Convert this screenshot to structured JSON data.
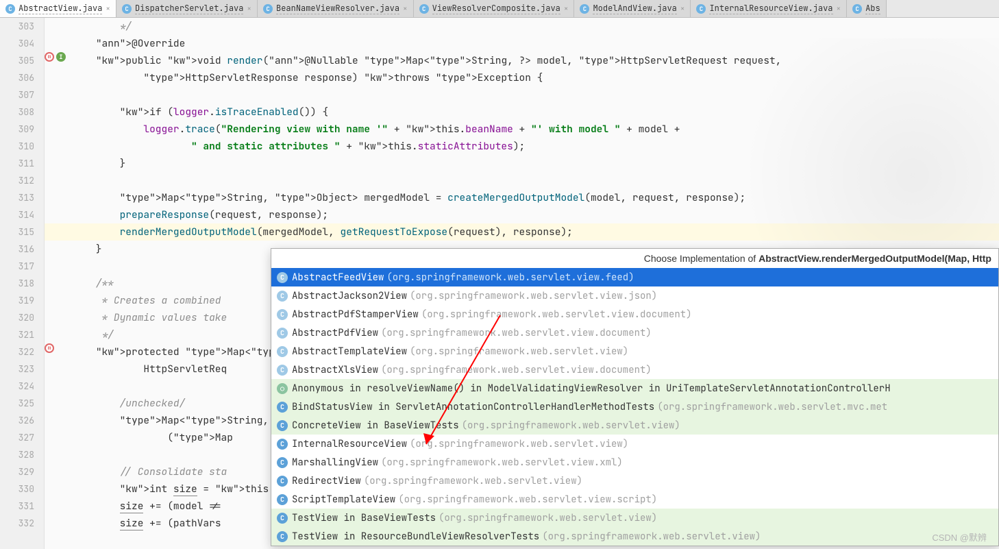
{
  "tabs": [
    {
      "label": "AbstractView.java",
      "active": true
    },
    {
      "label": "DispatcherServlet.java"
    },
    {
      "label": "BeanNameViewResolver.java"
    },
    {
      "label": "ViewResolverComposite.java"
    },
    {
      "label": "ModelAndView.java"
    },
    {
      "label": "InternalResourceView.java"
    },
    {
      "label": "Abs"
    }
  ],
  "gutter_start": 303,
  "gutter_end": 332,
  "code_lines": {
    "l303": "        */",
    "l304": "    @Override",
    "l305": "    public void render(@Nullable Map<String, ?> model, HttpServletRequest request,",
    "l306": "            HttpServletResponse response) throws Exception {",
    "l307": "",
    "l308": "        if (logger.isTraceEnabled()) {",
    "l309": "            logger.trace(\"Rendering view with name '\" + this.beanName + \"' with model \" + model +",
    "l310": "                    \" and static attributes \" + this.staticAttributes);",
    "l311": "        }",
    "l312": "",
    "l313": "        Map<String, Object> mergedModel = createMergedOutputModel(model, request, response);",
    "l314": "        prepareResponse(request, response);",
    "l315": "        renderMergedOutputModel(mergedModel, getRequestToExpose(request), response);",
    "l316": "    }",
    "l317": "",
    "l318": "    /**",
    "l319": "     * Creates a combined ",
    "l320": "     * Dynamic values take",
    "l321": "     */",
    "l322": "    protected Map<String, ",
    "l323": "            HttpServletReq",
    "l324": "",
    "l325": "        /unchecked/",
    "l326": "        Map<String, Object",
    "l327": "                (Map<Strin",
    "l328": "",
    "l329": "        // Consolidate sta",
    "l330": "        int size = this.st",
    "l331": "        size += (model != ",
    "l332": "        size += (pathVars "
  },
  "popup": {
    "title_prefix": "Choose Implementation of ",
    "title_bold": "AbstractView.renderMergedOutputModel(Map, Http",
    "items": [
      {
        "name": "AbstractFeedView",
        "pkg": "(org.springframework.web.servlet.view.feed)",
        "sel": true,
        "abs": true
      },
      {
        "name": "AbstractJackson2View",
        "pkg": "(org.springframework.web.servlet.view.json)",
        "abs": true
      },
      {
        "name": "AbstractPdfStamperView",
        "pkg": "(org.springframework.web.servlet.view.document)",
        "abs": true
      },
      {
        "name": "AbstractPdfView",
        "pkg": "(org.springframework.web.servlet.view.document)",
        "abs": true
      },
      {
        "name": "AbstractTemplateView",
        "pkg": "(org.springframework.web.servlet.view)",
        "abs": true
      },
      {
        "name": "AbstractXlsView",
        "pkg": "(org.springframework.web.servlet.view.document)",
        "abs": true
      },
      {
        "name": "Anonymous in resolveViewName() in ModelValidatingViewResolver in UriTemplateServletAnnotationControllerH",
        "pkg": "",
        "green": true,
        "anon": true
      },
      {
        "name": "BindStatusView in ServletAnnotationControllerHandlerMethodTests",
        "pkg": "(org.springframework.web.servlet.mvc.met",
        "green": true
      },
      {
        "name": "ConcreteView in BaseViewTests",
        "pkg": "(org.springframework.web.servlet.view)",
        "green": true
      },
      {
        "name": "InternalResourceView",
        "pkg": "(org.springframework.web.servlet.view)"
      },
      {
        "name": "MarshallingView",
        "pkg": "(org.springframework.web.servlet.view.xml)"
      },
      {
        "name": "RedirectView",
        "pkg": "(org.springframework.web.servlet.view)"
      },
      {
        "name": "ScriptTemplateView",
        "pkg": "(org.springframework.web.servlet.view.script)"
      },
      {
        "name": "TestView in BaseViewTests",
        "pkg": "(org.springframework.web.servlet.view)",
        "green": true
      },
      {
        "name": "TestView in ResourceBundleViewResolverTests",
        "pkg": "(org.springframework.web.servlet.view)",
        "green": true
      }
    ]
  },
  "watermark": "CSDN @默辨"
}
